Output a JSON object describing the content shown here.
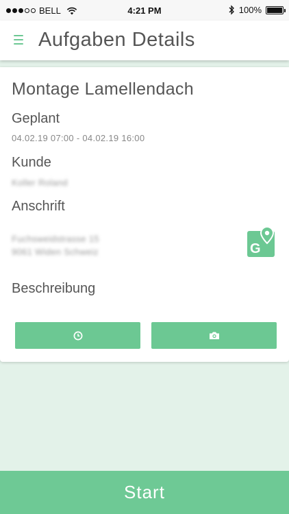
{
  "status_bar": {
    "carrier": "BELL",
    "time": "4:21 PM",
    "battery": "100%",
    "signal_bars_filled": 3,
    "signal_bars_total": 5
  },
  "header": {
    "title": "Aufgaben Details",
    "menu_icon": "hamburger-menu-icon"
  },
  "task": {
    "title": "Montage Lamellendach",
    "planned_label": "Geplant",
    "planned_value": "04.02.19 07:00 - 04.02.19 16:00",
    "customer_label": "Kunde",
    "customer_value": "Koller Roland",
    "address_label": "Anschrift",
    "address_line1": "Fuchsweidstrasse 15",
    "address_line2": "9061 Widen Schweiz",
    "description_label": "Beschreibung"
  },
  "actions": {
    "time_icon": "clock-icon",
    "photo_icon": "camera-icon",
    "maps_icon": "google-maps-icon"
  },
  "footer": {
    "start_label": "Start"
  },
  "colors": {
    "accent": "#6cc893",
    "background": "#e3f2e9"
  }
}
